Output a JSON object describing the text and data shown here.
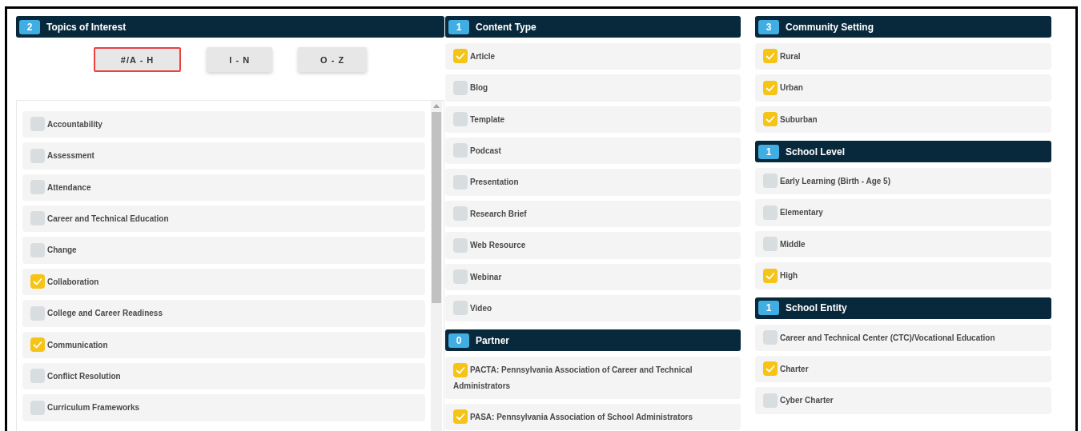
{
  "topics": {
    "count": "2",
    "title": "Topics of Interest",
    "letter_tabs": [
      {
        "label": "#/A - H",
        "selected": true
      },
      {
        "label": "I - N",
        "selected": false
      },
      {
        "label": "O - Z",
        "selected": false
      }
    ],
    "items": [
      {
        "label": "Accountability",
        "checked": false
      },
      {
        "label": "Assessment",
        "checked": false
      },
      {
        "label": "Attendance",
        "checked": false
      },
      {
        "label": "Career and Technical Education",
        "checked": false
      },
      {
        "label": "Change",
        "checked": false
      },
      {
        "label": "Collaboration",
        "checked": true
      },
      {
        "label": "College and Career Readiness",
        "checked": false
      },
      {
        "label": "Communication",
        "checked": true
      },
      {
        "label": "Conflict Resolution",
        "checked": false
      },
      {
        "label": "Curriculum Frameworks",
        "checked": false
      }
    ]
  },
  "middle_column": [
    {
      "count": "1",
      "title": "Content Type",
      "items": [
        {
          "label": "Article",
          "checked": true
        },
        {
          "label": "Blog",
          "checked": false
        },
        {
          "label": "Template",
          "checked": false
        },
        {
          "label": "Podcast",
          "checked": false
        },
        {
          "label": "Presentation",
          "checked": false
        },
        {
          "label": "Research Brief",
          "checked": false
        },
        {
          "label": "Web Resource",
          "checked": false
        },
        {
          "label": "Webinar",
          "checked": false
        },
        {
          "label": "Video",
          "checked": false
        }
      ]
    },
    {
      "count": "0",
      "title": "Partner",
      "items": [
        {
          "label": "PACTA: Pennsylvania Association of Career and Technical Administrators",
          "checked": true
        },
        {
          "label": "PASA: Pennsylvania Association of School Administrators",
          "checked": true
        }
      ]
    }
  ],
  "right_column": [
    {
      "count": "3",
      "title": "Community Setting",
      "items": [
        {
          "label": "Rural",
          "checked": true
        },
        {
          "label": "Urban",
          "checked": true
        },
        {
          "label": "Suburban",
          "checked": true
        }
      ]
    },
    {
      "count": "1",
      "title": "School Level",
      "items": [
        {
          "label": "Early Learning (Birth - Age 5)",
          "checked": false
        },
        {
          "label": "Elementary",
          "checked": false
        },
        {
          "label": "Middle",
          "checked": false
        },
        {
          "label": "High",
          "checked": true
        }
      ]
    },
    {
      "count": "1",
      "title": "School Entity",
      "items": [
        {
          "label": "Career and Technical Center (CTC)/Vocational Education",
          "checked": false
        },
        {
          "label": "Charter",
          "checked": true
        },
        {
          "label": "Cyber Charter",
          "checked": false
        }
      ]
    }
  ]
}
